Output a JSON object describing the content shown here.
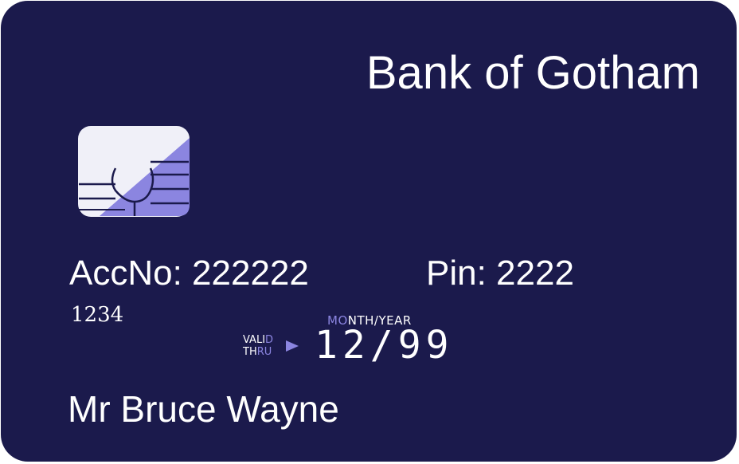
{
  "card": {
    "bank_name": "Bank of Gotham",
    "account_label": "AccNo: 222222",
    "pin_label": "Pin: 2222",
    "sub_number": "1234",
    "month_year_prefix": "MO",
    "month_year_rest": "NTH/YEAR",
    "valid_line1_a": "VALI",
    "valid_line1_b": "D",
    "valid_line2_a": "TH",
    "valid_line2_b": "RU",
    "expiry": "12/99",
    "holder_name": "Mr Bruce Wayne"
  },
  "colors": {
    "card_background": "#1b1a4c",
    "accent": "#8b85e0",
    "chip_light": "#f0f0f8",
    "text": "#ffffff"
  },
  "icons": {
    "chip": "chip-icon",
    "arrow": "arrow-right-icon"
  }
}
